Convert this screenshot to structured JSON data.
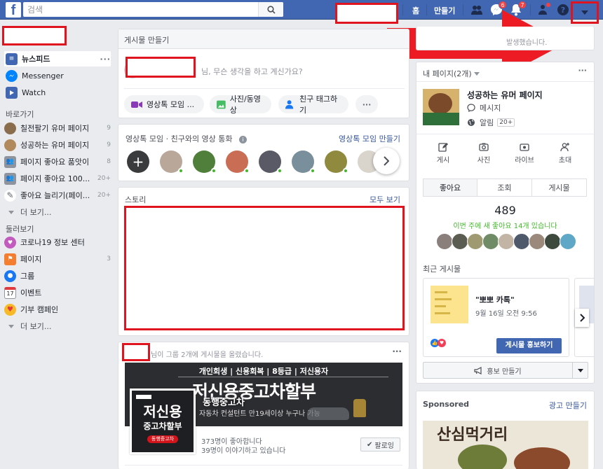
{
  "topbar": {
    "logo": "f",
    "search_placeholder": "검색",
    "nav": {
      "home": "홈",
      "create": "만들기"
    },
    "badges": {
      "messenger": "6",
      "notifications": "7"
    }
  },
  "left_nav": {
    "main": [
      {
        "label": "뉴스피드"
      },
      {
        "label": "Messenger"
      },
      {
        "label": "Watch"
      }
    ],
    "shortcuts_title": "바로가기",
    "shortcuts": [
      {
        "label": "칠전팔기 유머 페이지",
        "count": "9"
      },
      {
        "label": "성공하는 유머 페이지",
        "count": "9"
      },
      {
        "label": "페이지 좋아요 품앗이",
        "count": "8"
      },
      {
        "label": "페이지 좋아요 100...",
        "count": "20+"
      },
      {
        "label": "좋아요 늘리기(페이...",
        "count": "20+"
      }
    ],
    "see_more": "더 보기...",
    "explore_title": "둘러보기",
    "explore": [
      {
        "label": "코로나19 정보 센터",
        "count": ""
      },
      {
        "label": "페이지",
        "count": "3"
      },
      {
        "label": "그룹",
        "count": ""
      },
      {
        "label": "이벤트",
        "count": ""
      },
      {
        "label": "기부 캠페인",
        "count": ""
      }
    ],
    "see_more2": "더 보기...",
    "event_day": "17"
  },
  "composer": {
    "title": "게시물 만들기",
    "prompt": "님, 무슨 생각을 하고 계신가요?",
    "actions": [
      "영상톡 모임 ...",
      "사진/동영상",
      "친구 태그하기"
    ]
  },
  "rooms": {
    "title": "영상톡 모임 · 친구와의 영상 통화",
    "link": "영상톡 모임 만들기"
  },
  "stories": {
    "title": "스토리",
    "see_all": "모두 보기"
  },
  "post": {
    "header": "님이 그룹 2개에 게시물을 올렸습니다.",
    "banner_tags": "개인회생 | 신용회복 | 8등급 | 저신용자",
    "banner_title": "저신용중고차할부",
    "banner_sub": "자동차 컨설턴트 만19세이상 누구나 가능",
    "page_name": "동행중고차",
    "logo_line1": "저신용",
    "logo_line2": "중고차할부",
    "logo_tag": "동행중고차",
    "likes": "373명이 좋아합니다",
    "talking": "39명이 이야기하고 있습니다",
    "follow": "팔로잉"
  },
  "right": {
    "top_text": "발생했습니다.",
    "pages_title": "내 페이지(2개)",
    "page_name": "성공하는 유머 페이지",
    "messages": "메시지",
    "notifications": "알림",
    "notif_badge": "20+",
    "actions": [
      "게시",
      "사진",
      "라이브",
      "초대"
    ],
    "tabs": [
      "좋아요",
      "조회",
      "게시물"
    ],
    "likes_count": "489",
    "likes_sub": "이번 주에 새 좋아요 14개 있습니다",
    "recent_title": "최근 게시물",
    "recent_post_title": "\"뽀뽀 카톡\"",
    "recent_post_date": "9월 16일 오전 9:56",
    "promote_btn": "게시물 홍보하기",
    "create_promo": "홍보 만들기",
    "sponsored": "Sponsored",
    "create_ad": "광고 만들기",
    "ad_text": "산심먹거리"
  },
  "colors": {
    "brand": "#4267b2",
    "link": "#385898",
    "online": "#42b72a",
    "badge": "#fa3e3e",
    "highlight": "#e0141e"
  }
}
